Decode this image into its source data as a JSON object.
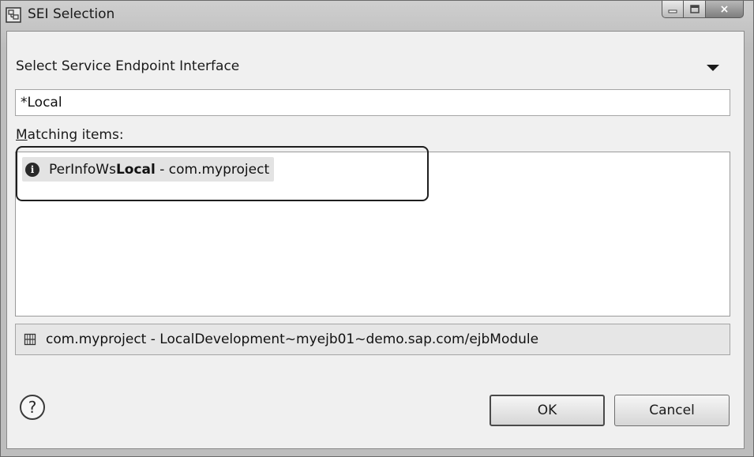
{
  "window": {
    "title": "SEI Selection",
    "controls": {
      "minimize": "minimize-icon",
      "maximize": "maximize-icon",
      "close": "×"
    }
  },
  "header": {
    "label": "Select Service Endpoint Interface",
    "menu_icon": "dropdown-triangle-icon"
  },
  "filter": {
    "value": "*Local"
  },
  "matching": {
    "label_mnemonic": "M",
    "label_rest": "atching items:",
    "items": [
      {
        "icon": "info-icon",
        "icon_glyph": "i",
        "name_prefix": "PerInfoWs",
        "name_match": "Local",
        "suffix": " - com.myproject"
      }
    ]
  },
  "location": {
    "icon": "package-icon",
    "text": "com.myproject - LocalDevelopment~myejb01~demo.sap.com/ejbModule"
  },
  "footer": {
    "help_glyph": "?",
    "ok_label": "OK",
    "cancel_label": "Cancel"
  }
}
